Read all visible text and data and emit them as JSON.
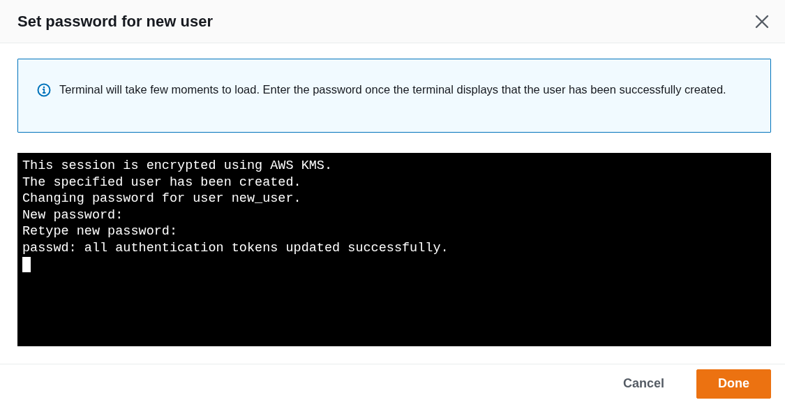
{
  "dialog": {
    "title": "Set password for new user"
  },
  "info": {
    "message": "Terminal will take few moments to load. Enter the password once the terminal displays that the user has been successfully created."
  },
  "terminal": {
    "lines": [
      "This session is encrypted using AWS KMS.",
      "The specified user has been created.",
      "Changing password for user new_user.",
      "New password:",
      "Retype new password:",
      "passwd: all authentication tokens updated successfully."
    ],
    "cursor": true
  },
  "buttons": [
    {
      "label": "Cancel",
      "kind": "link"
    },
    {
      "label": "Done",
      "kind": "primary"
    }
  ]
}
